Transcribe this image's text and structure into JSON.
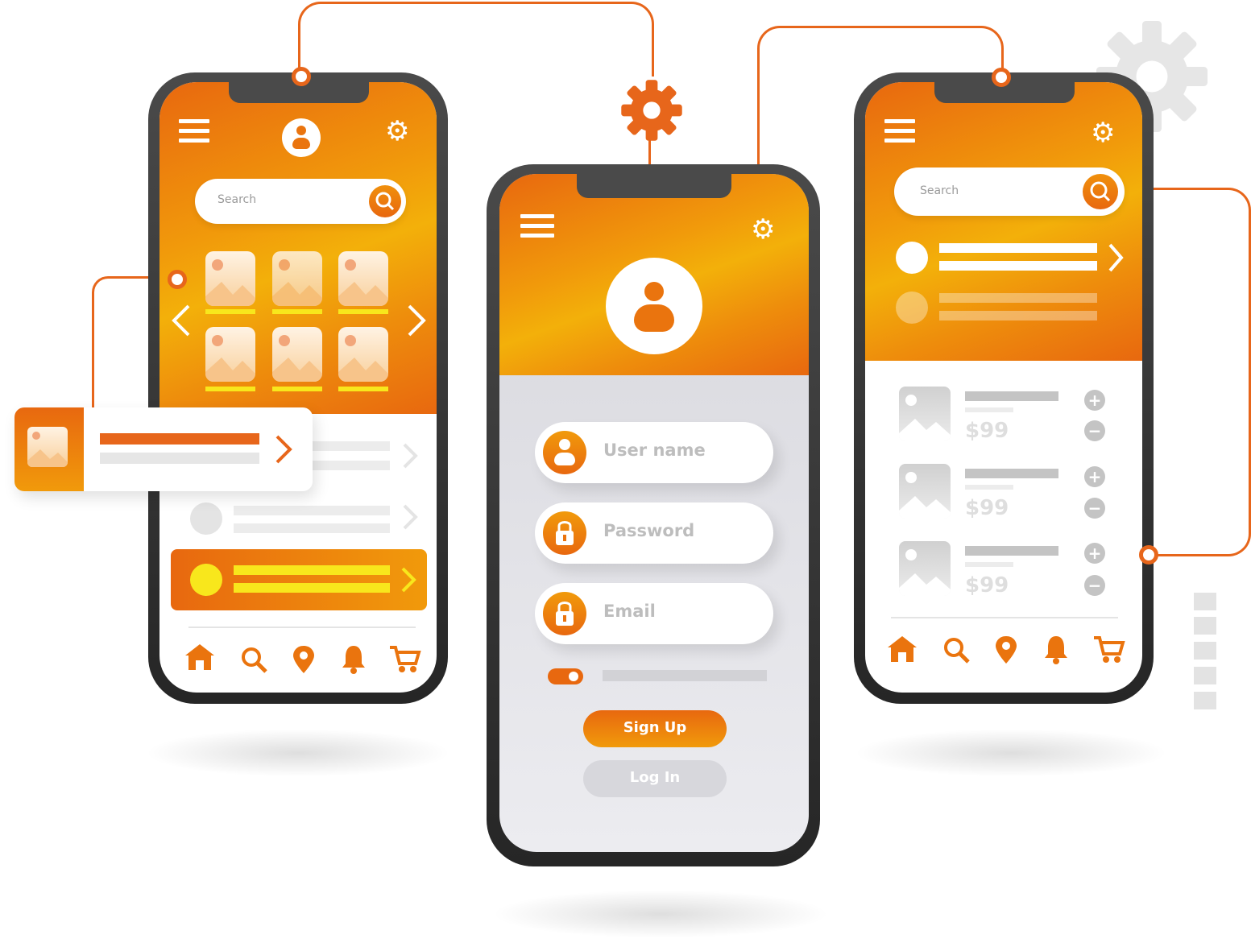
{
  "left_phone": {
    "search_placeholder": "Search",
    "nav_icons": [
      "home-icon",
      "search-icon",
      "location-icon",
      "bell-icon",
      "cart-icon"
    ]
  },
  "center_phone": {
    "fields": [
      {
        "label": "User name",
        "icon": "user-icon"
      },
      {
        "label": "Password",
        "icon": "lock-icon"
      },
      {
        "label": "Email",
        "icon": "lock-icon"
      }
    ],
    "signup_label": "Sign Up",
    "login_label": "Log In"
  },
  "right_phone": {
    "search_placeholder": "Search",
    "products": [
      {
        "price": "$99"
      },
      {
        "price": "$99"
      },
      {
        "price": "$99"
      }
    ],
    "nav_icons": [
      "home-icon",
      "search-icon",
      "location-icon",
      "bell-icon",
      "cart-icon"
    ]
  },
  "colors": {
    "accent": "#e8680f",
    "accent_light": "#f3b00a",
    "highlight": "#f8e71c",
    "wire": "#e7661b"
  }
}
